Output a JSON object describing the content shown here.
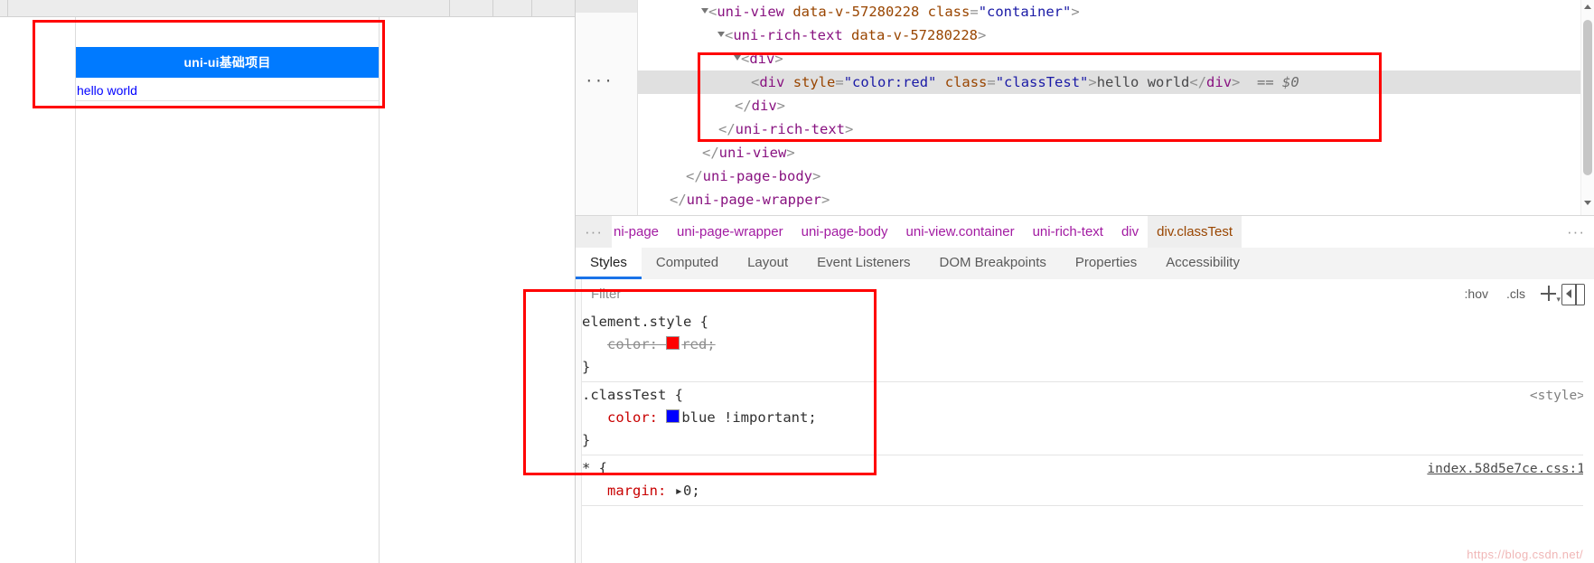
{
  "preview": {
    "app_title": "uni-ui基础项目",
    "body_text": "hello world",
    "header_bg": "#007aff",
    "body_text_color": "#0000ff"
  },
  "devtools": {
    "dom_tree": [
      {
        "id": "uni-view-open",
        "indent": 4,
        "has_triangle": true,
        "selected": false,
        "tokens": [
          {
            "cls": "tok-punc",
            "t": "<"
          },
          {
            "cls": "tok-tag",
            "t": "uni-view"
          },
          {
            "cls": "tok-punc",
            "t": " "
          },
          {
            "cls": "tok-attr",
            "t": "data-v-57280228"
          },
          {
            "cls": "tok-punc",
            "t": " "
          },
          {
            "cls": "tok-attr",
            "t": "class"
          },
          {
            "cls": "tok-punc",
            "t": "="
          },
          {
            "cls": "tok-val",
            "t": "\"container\""
          },
          {
            "cls": "tok-punc",
            "t": ">"
          }
        ]
      },
      {
        "id": "uni-rich-text-open",
        "indent": 5,
        "has_triangle": true,
        "selected": false,
        "tokens": [
          {
            "cls": "tok-punc",
            "t": "<"
          },
          {
            "cls": "tok-tag",
            "t": "uni-rich-text"
          },
          {
            "cls": "tok-punc",
            "t": " "
          },
          {
            "cls": "tok-attr",
            "t": "data-v-57280228"
          },
          {
            "cls": "tok-punc",
            "t": ">"
          }
        ]
      },
      {
        "id": "div-open",
        "indent": 6,
        "has_triangle": true,
        "selected": false,
        "tokens": [
          {
            "cls": "tok-punc",
            "t": "<"
          },
          {
            "cls": "tok-tag",
            "t": "div"
          },
          {
            "cls": "tok-punc",
            "t": ">"
          }
        ]
      },
      {
        "id": "div-classtest",
        "indent": 7,
        "has_triangle": false,
        "selected": true,
        "ellipsis": "···",
        "tokens": [
          {
            "cls": "tok-punc",
            "t": "<"
          },
          {
            "cls": "tok-tag",
            "t": "div"
          },
          {
            "cls": "tok-punc",
            "t": " "
          },
          {
            "cls": "tok-attr",
            "t": "style"
          },
          {
            "cls": "tok-punc",
            "t": "="
          },
          {
            "cls": "tok-val",
            "t": "\"color:red\""
          },
          {
            "cls": "tok-punc",
            "t": " "
          },
          {
            "cls": "tok-attr",
            "t": "class"
          },
          {
            "cls": "tok-punc",
            "t": "="
          },
          {
            "cls": "tok-val",
            "t": "\"classTest\""
          },
          {
            "cls": "tok-punc",
            "t": ">"
          },
          {
            "cls": "tok-text",
            "t": "hello world"
          },
          {
            "cls": "tok-punc",
            "t": "</"
          },
          {
            "cls": "tok-tag",
            "t": "div"
          },
          {
            "cls": "tok-punc",
            "t": ">"
          },
          {
            "cls": "tok-sel",
            "t": "  == $0"
          }
        ]
      },
      {
        "id": "div-close",
        "indent": 6,
        "has_triangle": false,
        "selected": false,
        "tokens": [
          {
            "cls": "tok-punc",
            "t": "</"
          },
          {
            "cls": "tok-tag",
            "t": "div"
          },
          {
            "cls": "tok-punc",
            "t": ">"
          }
        ]
      },
      {
        "id": "uni-rich-text-close",
        "indent": 5,
        "has_triangle": false,
        "selected": false,
        "tokens": [
          {
            "cls": "tok-punc",
            "t": "</"
          },
          {
            "cls": "tok-tag",
            "t": "uni-rich-text"
          },
          {
            "cls": "tok-punc",
            "t": ">"
          }
        ]
      },
      {
        "id": "uni-view-close",
        "indent": 4,
        "has_triangle": false,
        "selected": false,
        "tokens": [
          {
            "cls": "tok-punc",
            "t": "</"
          },
          {
            "cls": "tok-tag",
            "t": "uni-view"
          },
          {
            "cls": "tok-punc",
            "t": ">"
          }
        ]
      },
      {
        "id": "uni-page-body-close",
        "indent": 3,
        "has_triangle": false,
        "selected": false,
        "tokens": [
          {
            "cls": "tok-punc",
            "t": "</"
          },
          {
            "cls": "tok-tag",
            "t": "uni-page-body"
          },
          {
            "cls": "tok-punc",
            "t": ">"
          }
        ]
      },
      {
        "id": "uni-page-wrapper-close",
        "indent": 2,
        "has_triangle": false,
        "selected": false,
        "tokens": [
          {
            "cls": "tok-punc",
            "t": "</"
          },
          {
            "cls": "tok-tag",
            "t": "uni-page-wrapper"
          },
          {
            "cls": "tok-punc",
            "t": ">"
          }
        ]
      }
    ],
    "breadcrumb": {
      "leading_more": "···",
      "items": [
        {
          "label": "ni-page",
          "active": false,
          "clipped": true
        },
        {
          "label": "uni-page-wrapper",
          "active": false
        },
        {
          "label": "uni-page-body",
          "active": false
        },
        {
          "label": "uni-view.container",
          "active": false
        },
        {
          "label": "uni-rich-text",
          "active": false
        },
        {
          "label": "div",
          "active": false
        },
        {
          "label": "div.classTest",
          "active": true
        }
      ],
      "trailing_more": "···"
    },
    "sidebar_tabs": [
      {
        "label": "Styles",
        "active": true
      },
      {
        "label": "Computed",
        "active": false
      },
      {
        "label": "Layout",
        "active": false
      },
      {
        "label": "Event Listeners",
        "active": false
      },
      {
        "label": "DOM Breakpoints",
        "active": false
      },
      {
        "label": "Properties",
        "active": false
      },
      {
        "label": "Accessibility",
        "active": false
      }
    ],
    "filter_bar": {
      "placeholder": "Filter",
      "value": "",
      "hov_label": ":hov",
      "cls_label": ".cls",
      "new_rule_label": "+",
      "new_rule_sub": "▾"
    },
    "style_rules": [
      {
        "id": "element-style",
        "selector": "element.style {",
        "close": "}",
        "origin": "",
        "origin_is_link": false,
        "declarations": [
          {
            "property": "color",
            "value": "red",
            "swatch": "#ff0000",
            "inactive": true,
            "important": false
          }
        ]
      },
      {
        "id": "classtest-rule",
        "selector": ".classTest {",
        "close": "}",
        "origin": "<style>",
        "origin_is_link": false,
        "declarations": [
          {
            "property": "color",
            "value": "blue",
            "swatch": "#0000ff",
            "inactive": false,
            "important": true,
            "important_text": "!important"
          }
        ]
      },
      {
        "id": "universal-rule",
        "selector": "* {",
        "close": "",
        "origin": "index.58d5e7ce.css:1",
        "origin_is_link": true,
        "declarations": [
          {
            "property": "margin",
            "value": "0",
            "swatch": "",
            "inactive": false,
            "important": false,
            "expandable": true
          }
        ]
      }
    ]
  },
  "watermark": "https://blog.csdn.net/"
}
